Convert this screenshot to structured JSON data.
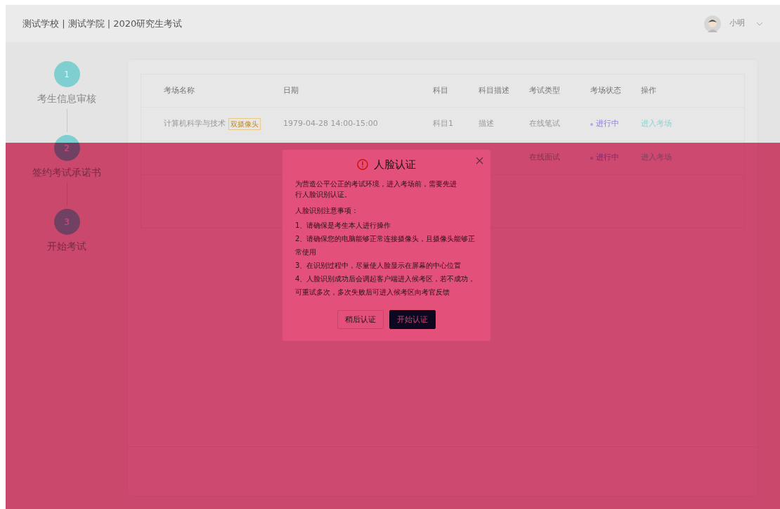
{
  "header": {
    "title": "测试学校 | 测试学院 | 2020研究生考试",
    "user": "小明"
  },
  "steps": [
    {
      "number": "1",
      "label": "考生信息审核"
    },
    {
      "number": "2",
      "label": "签约考试承诺书"
    },
    {
      "number": "3",
      "label": "开始考试"
    }
  ],
  "table": {
    "columns": [
      "考场名称",
      "日期",
      "科目",
      "科目描述",
      "考试类型",
      "考场状态",
      "操作"
    ],
    "rows": [
      {
        "name": "计算机科学与技术",
        "tag": "双摄像头",
        "date": "1979-04-28  14:00-15:00",
        "subject": "科目1",
        "description": "描述",
        "type": "在线笔试",
        "status": "进行中",
        "action": "进入考场"
      },
      {
        "type": "在线面试",
        "status": "进行中",
        "action": "进入考场"
      }
    ]
  },
  "modal": {
    "title": "人脸认证",
    "intro": "为营造公平公正的考试环境，进入考场前，需要先进行人脸识别认证。",
    "notes_title": "人脸识别注意事项：",
    "notes": [
      "1、请确保是考生本人进行操作",
      "2、请确保您的电脑能够正常连接摄像头，且摄像头能够正常使用",
      "3、在识别过程中，尽量使人脸显示在屏幕的中心位置",
      "4、人脸识别成功后会调起客户端进入候考区，若不成功，可重试多次，多次失败后可进入候考区向考官反馈"
    ],
    "buttons": [
      {
        "label": "稍后认证",
        "kind": "secondary"
      },
      {
        "label": "开始认证",
        "kind": "primary"
      }
    ]
  }
}
